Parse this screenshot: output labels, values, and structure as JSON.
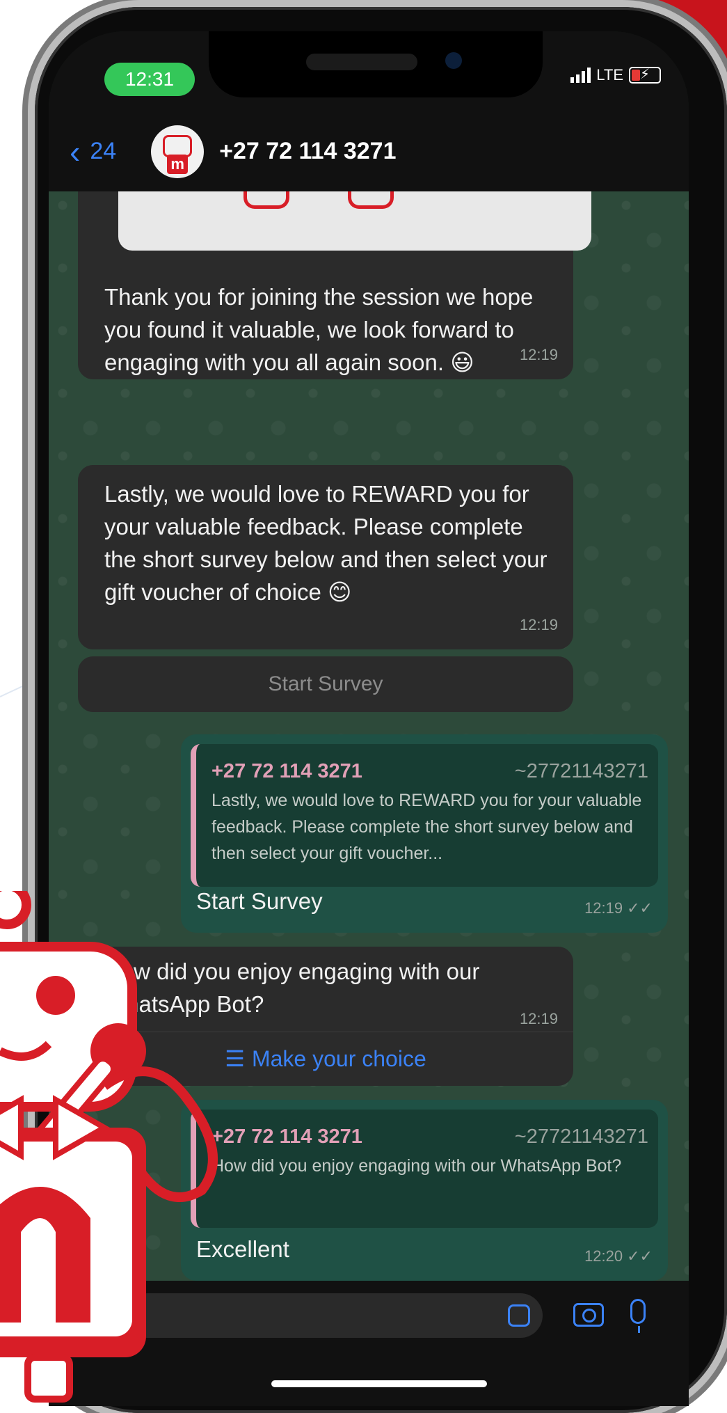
{
  "status_bar": {
    "time": "12:31",
    "network": "LTE"
  },
  "header": {
    "back_count": "24",
    "contact": "+27 72 114 3271"
  },
  "messages": {
    "thankyou": {
      "text": "Thank you for joining the session we hope you found it valuable, we look forward to engaging with you all again soon. 😃",
      "time": "12:19"
    },
    "reward": {
      "text": "Lastly, we would love to REWARD you for your valuable feedback. Please complete the short survey below and then select your gift voucher of choice 😊",
      "time": "12:19"
    },
    "start_survey_button": "Start Survey",
    "reply_survey": {
      "quote_name": "+27 72 114 3271",
      "quote_number": "~27721143271",
      "quote_text": "Lastly, we would love to REWARD you for your valuable feedback. Please complete the short survey below and then select your gift voucher...",
      "text": "Start Survey",
      "time": "12:19"
    },
    "how": {
      "text": "How did you enjoy engaging with our WhatsApp Bot?",
      "time": "12:19",
      "choice_label": "Make your choice"
    },
    "reply_excellent": {
      "quote_name": "+27 72 114 3271",
      "quote_number": "~27721143271",
      "quote_text": "How did you enjoy engaging with our WhatsApp Bot?",
      "text": "Excellent",
      "time": "12:20"
    }
  },
  "colors": {
    "brand_red": "#d81e27",
    "ios_blue": "#3b82f6",
    "status_green": "#34c759",
    "outgoing_bubble": "#1f5145"
  },
  "icons": [
    "back-chevron-icon",
    "sticker-icon",
    "camera-icon",
    "mic-icon",
    "list-icon",
    "double-check-icon"
  ]
}
